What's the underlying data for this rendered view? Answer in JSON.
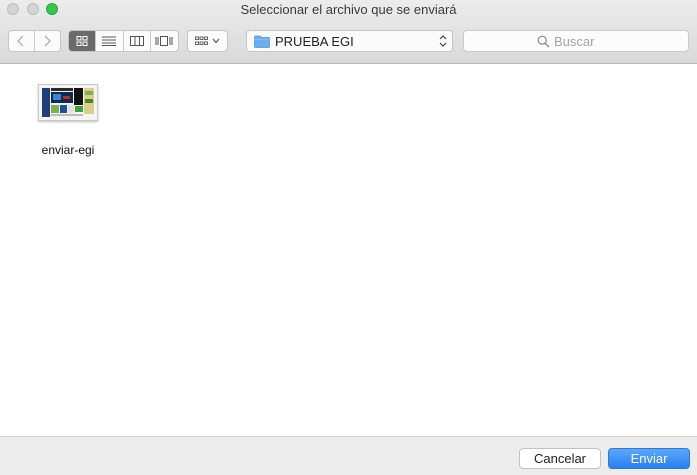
{
  "window": {
    "title": "Seleccionar el archivo que se enviará"
  },
  "toolbar": {
    "back_icon": "chevron-left-icon",
    "forward_icon": "chevron-right-icon",
    "view_modes": [
      "icon-view",
      "list-view",
      "column-view",
      "coverflow-view"
    ],
    "active_view": "icon-view",
    "arrange_icon": "arrange-grid-icon",
    "location": "PRUEBA EGI",
    "search": {
      "placeholder": "Buscar",
      "value": ""
    }
  },
  "files": [
    {
      "name": "enviar-egi"
    }
  ],
  "footer": {
    "cancel_label": "Cancelar",
    "send_label": "Enviar"
  },
  "colors": {
    "accent": "#2a7ff0",
    "zoom": "#34c84a",
    "folder": "#6aaef0"
  }
}
